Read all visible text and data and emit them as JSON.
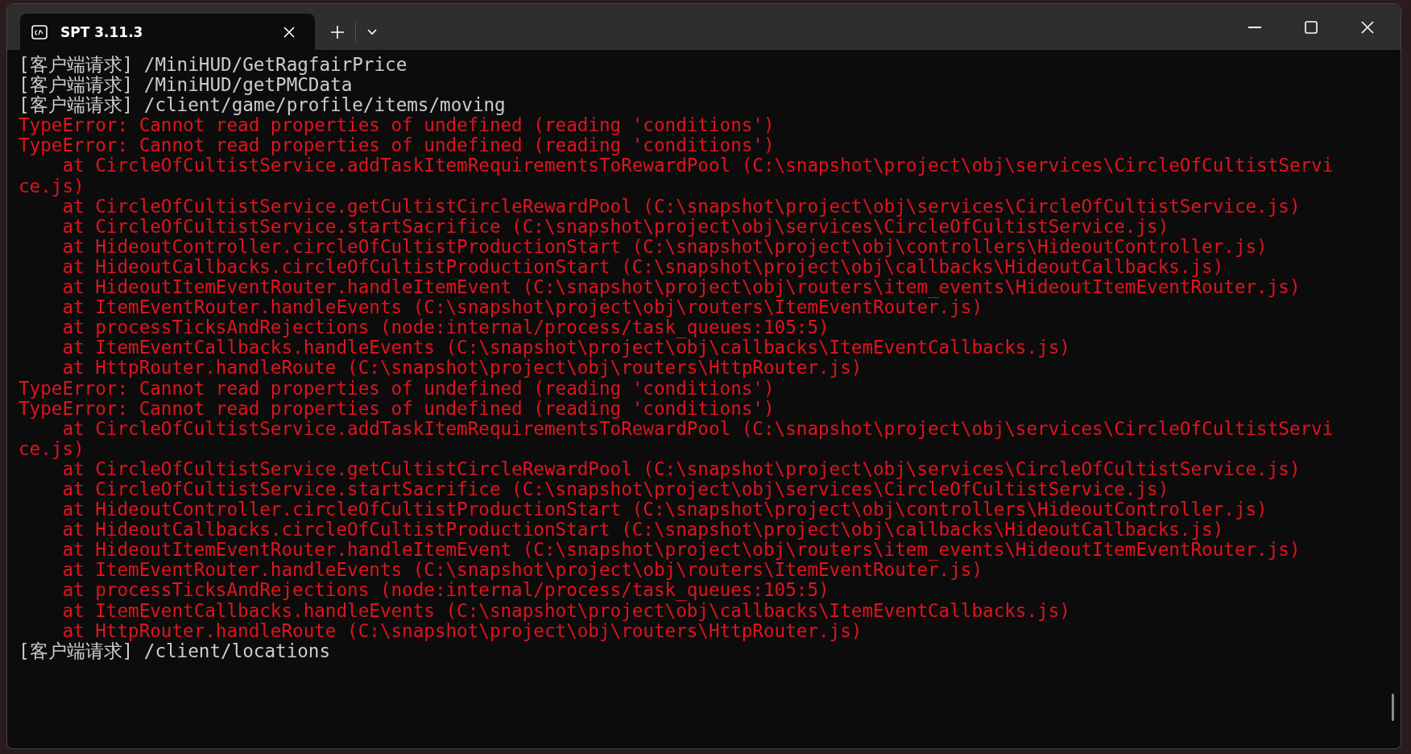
{
  "window": {
    "tab_title": "SPT 3.11.3"
  },
  "lines": [
    {
      "kind": "info",
      "text": "[客户端请求] /MiniHUD/GetRagfairPrice"
    },
    {
      "kind": "info",
      "text": "[客户端请求] /MiniHUD/getPMCData"
    },
    {
      "kind": "info",
      "text": "[客户端请求] /client/game/profile/items/moving"
    },
    {
      "kind": "error",
      "text": "TypeError: Cannot read properties of undefined (reading 'conditions')"
    },
    {
      "kind": "error",
      "text": "TypeError: Cannot read properties of undefined (reading 'conditions')"
    },
    {
      "kind": "error",
      "text": "    at CircleOfCultistService.addTaskItemRequirementsToRewardPool (C:\\snapshot\\project\\obj\\services\\CircleOfCultistServi"
    },
    {
      "kind": "error",
      "text": "ce.js)"
    },
    {
      "kind": "error",
      "text": "    at CircleOfCultistService.getCultistCircleRewardPool (C:\\snapshot\\project\\obj\\services\\CircleOfCultistService.js)"
    },
    {
      "kind": "error",
      "text": "    at CircleOfCultistService.startSacrifice (C:\\snapshot\\project\\obj\\services\\CircleOfCultistService.js)"
    },
    {
      "kind": "error",
      "text": "    at HideoutController.circleOfCultistProductionStart (C:\\snapshot\\project\\obj\\controllers\\HideoutController.js)"
    },
    {
      "kind": "error",
      "text": "    at HideoutCallbacks.circleOfCultistProductionStart (C:\\snapshot\\project\\obj\\callbacks\\HideoutCallbacks.js)"
    },
    {
      "kind": "error",
      "text": "    at HideoutItemEventRouter.handleItemEvent (C:\\snapshot\\project\\obj\\routers\\item_events\\HideoutItemEventRouter.js)"
    },
    {
      "kind": "error",
      "text": "    at ItemEventRouter.handleEvents (C:\\snapshot\\project\\obj\\routers\\ItemEventRouter.js)"
    },
    {
      "kind": "error",
      "text": "    at processTicksAndRejections (node:internal/process/task_queues:105:5)"
    },
    {
      "kind": "error",
      "text": "    at ItemEventCallbacks.handleEvents (C:\\snapshot\\project\\obj\\callbacks\\ItemEventCallbacks.js)"
    },
    {
      "kind": "error",
      "text": "    at HttpRouter.handleRoute (C:\\snapshot\\project\\obj\\routers\\HttpRouter.js)"
    },
    {
      "kind": "error",
      "text": "TypeError: Cannot read properties of undefined (reading 'conditions')"
    },
    {
      "kind": "error",
      "text": "TypeError: Cannot read properties of undefined (reading 'conditions')"
    },
    {
      "kind": "error",
      "text": "    at CircleOfCultistService.addTaskItemRequirementsToRewardPool (C:\\snapshot\\project\\obj\\services\\CircleOfCultistServi"
    },
    {
      "kind": "error",
      "text": "ce.js)"
    },
    {
      "kind": "error",
      "text": "    at CircleOfCultistService.getCultistCircleRewardPool (C:\\snapshot\\project\\obj\\services\\CircleOfCultistService.js)"
    },
    {
      "kind": "error",
      "text": "    at CircleOfCultistService.startSacrifice (C:\\snapshot\\project\\obj\\services\\CircleOfCultistService.js)"
    },
    {
      "kind": "error",
      "text": "    at HideoutController.circleOfCultistProductionStart (C:\\snapshot\\project\\obj\\controllers\\HideoutController.js)"
    },
    {
      "kind": "error",
      "text": "    at HideoutCallbacks.circleOfCultistProductionStart (C:\\snapshot\\project\\obj\\callbacks\\HideoutCallbacks.js)"
    },
    {
      "kind": "error",
      "text": "    at HideoutItemEventRouter.handleItemEvent (C:\\snapshot\\project\\obj\\routers\\item_events\\HideoutItemEventRouter.js)"
    },
    {
      "kind": "error",
      "text": "    at ItemEventRouter.handleEvents (C:\\snapshot\\project\\obj\\routers\\ItemEventRouter.js)"
    },
    {
      "kind": "error",
      "text": "    at processTicksAndRejections (node:internal/process/task_queues:105:5)"
    },
    {
      "kind": "error",
      "text": "    at ItemEventCallbacks.handleEvents (C:\\snapshot\\project\\obj\\callbacks\\ItemEventCallbacks.js)"
    },
    {
      "kind": "error",
      "text": "    at HttpRouter.handleRoute (C:\\snapshot\\project\\obj\\routers\\HttpRouter.js)"
    },
    {
      "kind": "info",
      "text": "[客户端请求] /client/locations"
    }
  ]
}
